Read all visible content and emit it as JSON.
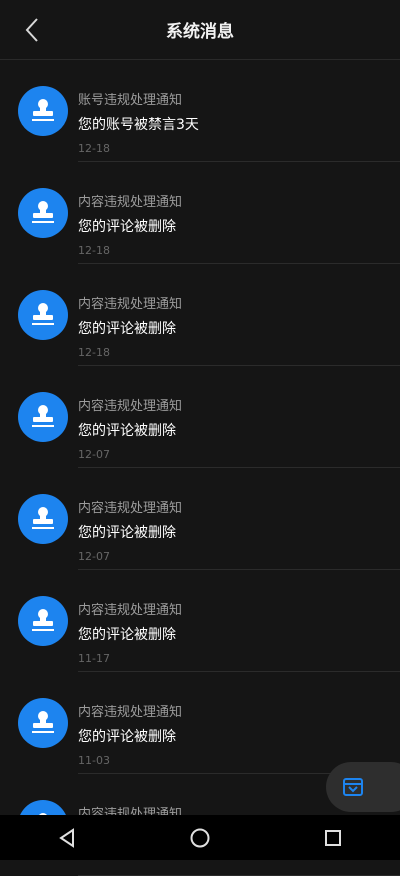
{
  "header": {
    "title": "系统消息",
    "back_icon": "chevron-left-icon"
  },
  "messages": [
    {
      "type": "账号违规处理通知",
      "text": "您的账号被禁言3天",
      "date": "12-18"
    },
    {
      "type": "内容违规处理通知",
      "text": "您的评论被删除",
      "date": "12-18"
    },
    {
      "type": "内容违规处理通知",
      "text": "您的评论被删除",
      "date": "12-18"
    },
    {
      "type": "内容违规处理通知",
      "text": "您的评论被删除",
      "date": "12-07"
    },
    {
      "type": "内容违规处理通知",
      "text": "您的评论被删除",
      "date": "12-07"
    },
    {
      "type": "内容违规处理通知",
      "text": "您的评论被删除",
      "date": "11-17"
    },
    {
      "type": "内容违规处理通知",
      "text": "您的评论被删除",
      "date": "11-03"
    },
    {
      "type": "内容违规处理通知",
      "text": "",
      "date": ""
    }
  ],
  "colors": {
    "accent": "#1d84ef",
    "background": "#151515"
  },
  "floating_button": {
    "icon": "inbox-icon"
  },
  "navbar": {
    "icons": [
      "back-triangle-icon",
      "home-circle-icon",
      "recents-square-icon"
    ]
  }
}
